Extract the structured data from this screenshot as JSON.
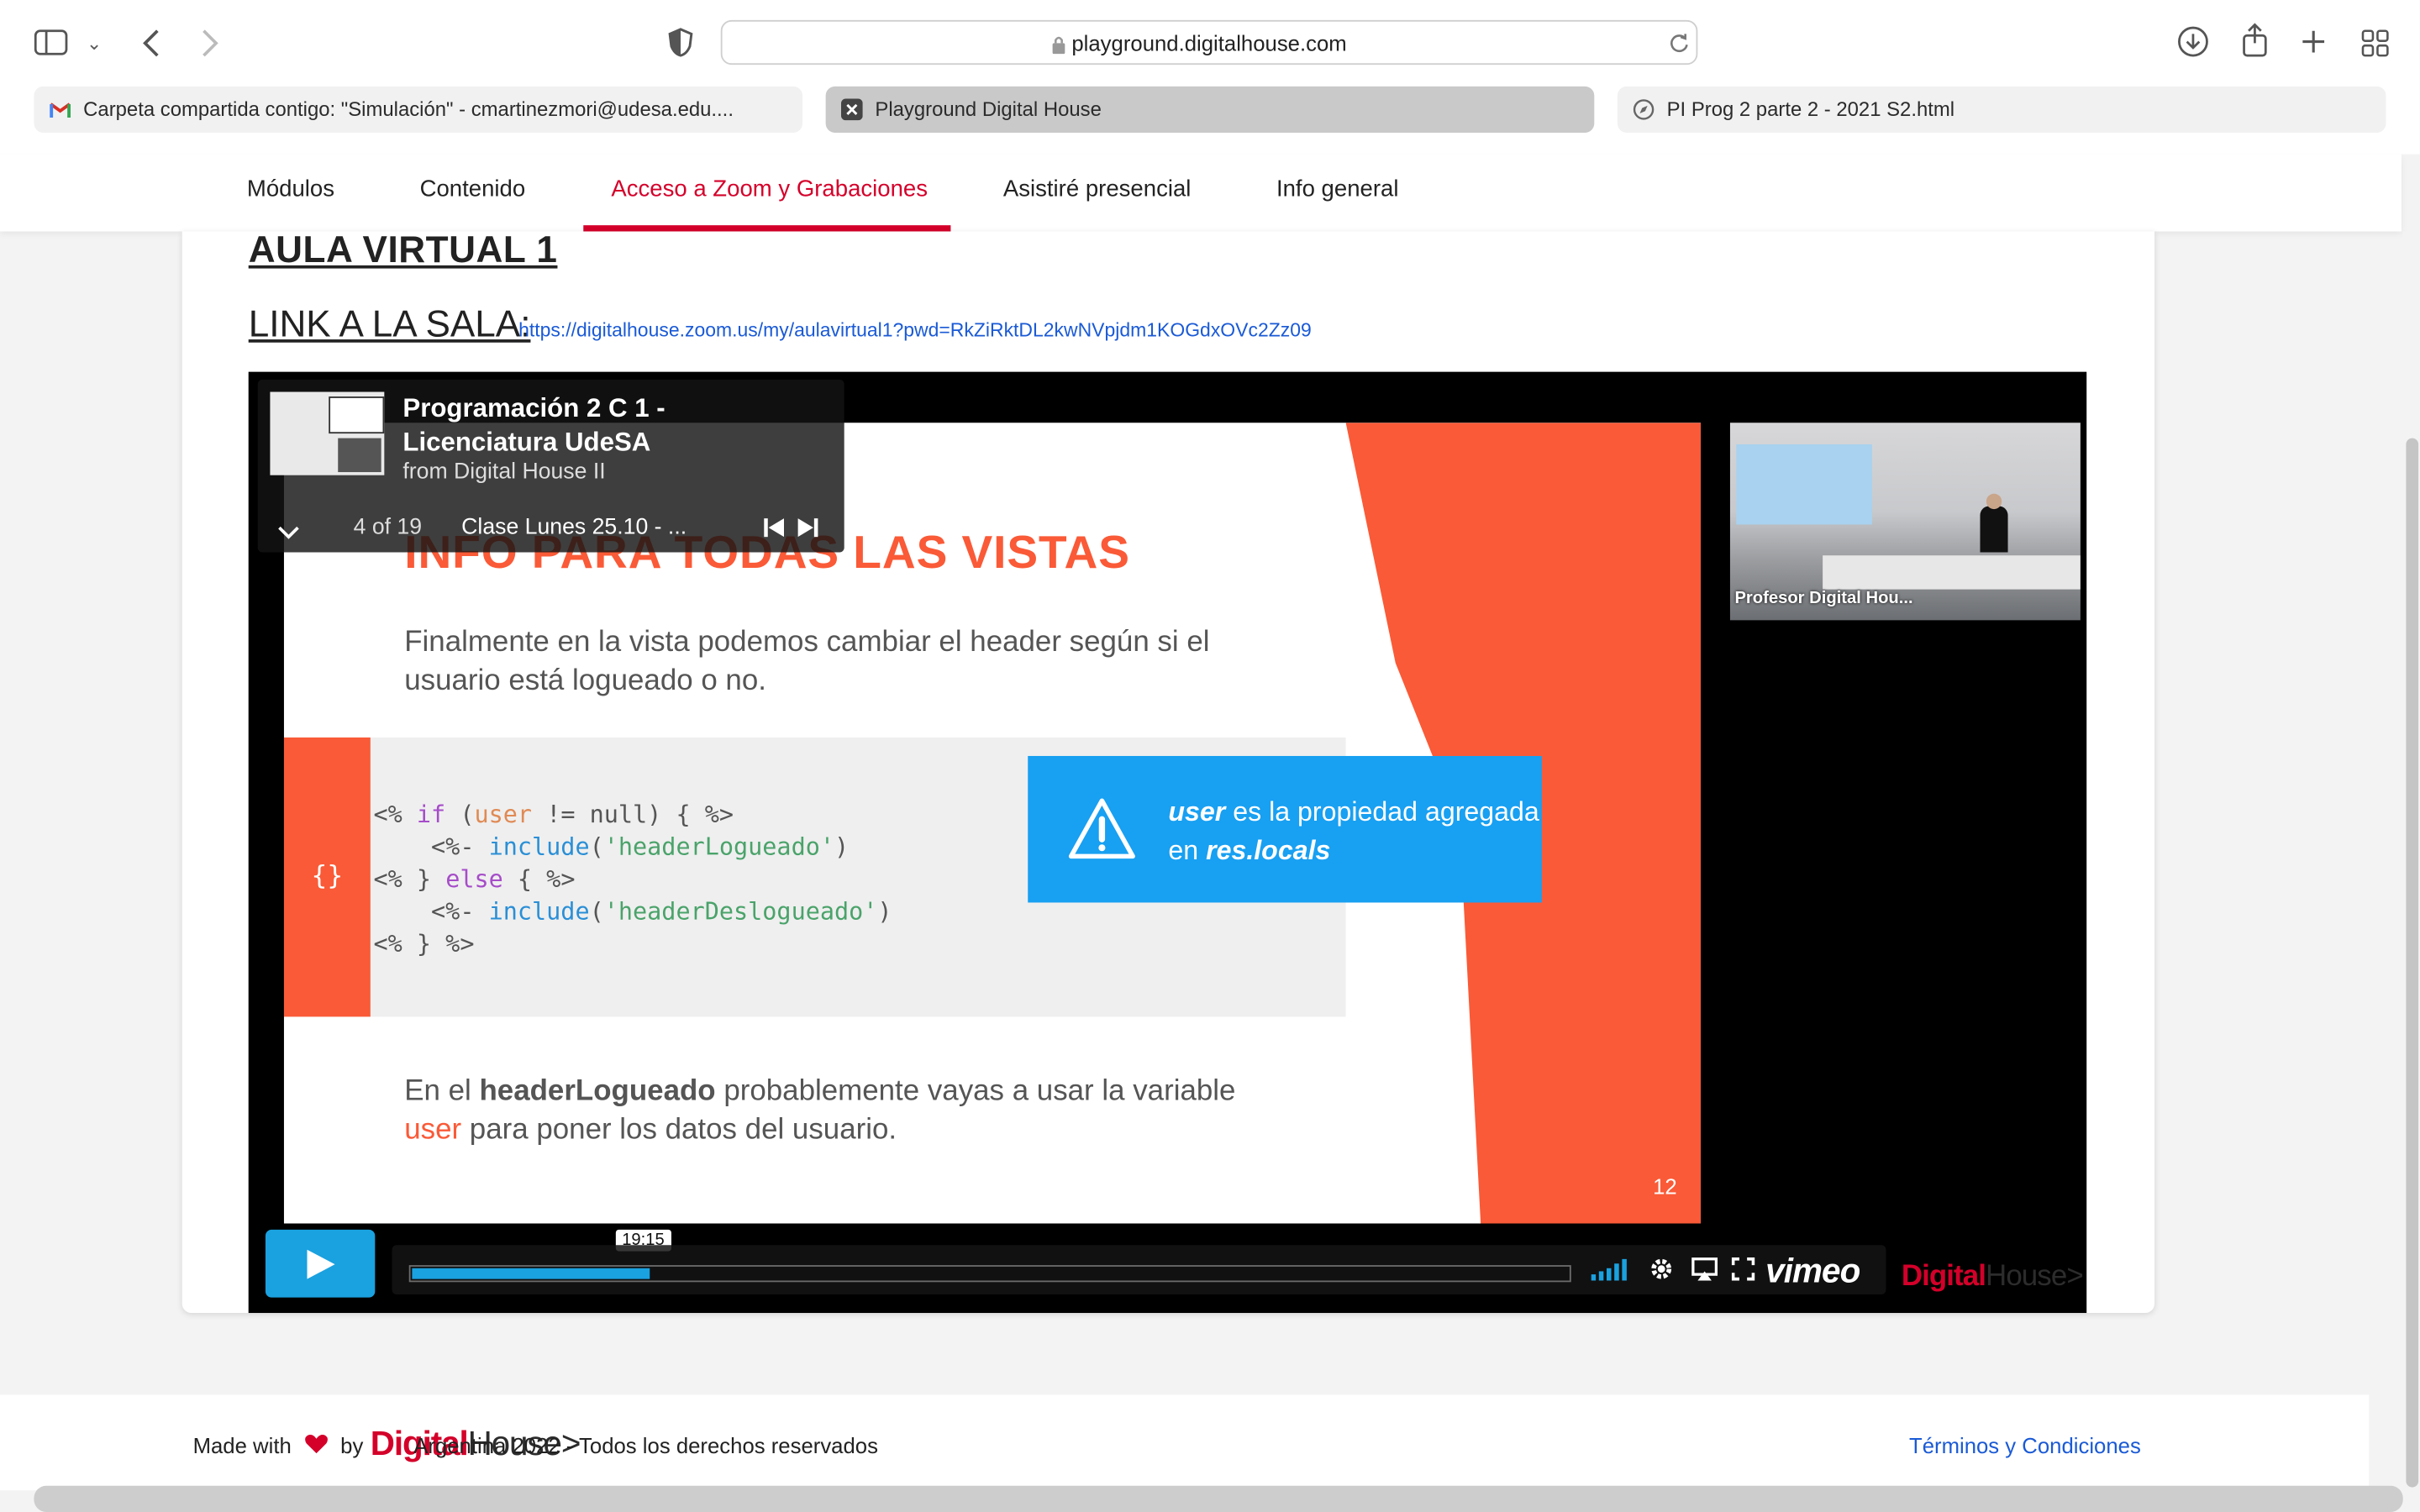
{
  "browser": {
    "url": "playground.digitalhouse.com",
    "tabs": [
      {
        "label": "Carpeta compartida contigo: \"Simulación\" - cmartinezmori@udesa.edu....",
        "icon": "gmail-icon"
      },
      {
        "label": "Playground Digital House",
        "icon": "close-icon"
      },
      {
        "label": "PI Prog 2 parte 2 - 2021 S2.html",
        "icon": "compass-icon"
      }
    ]
  },
  "nav": {
    "items": [
      "Módulos",
      "Contenido",
      "Acceso a Zoom y Grabaciones",
      "Asistiré presencial",
      "Info general"
    ],
    "active_index": 2
  },
  "main": {
    "heading": "AULA VIRTUAL 1",
    "link_label": "LINK A LA SALA:",
    "link_url": "https://digitalhouse.zoom.us/my/aulavirtual1?pwd=RkZiRktDL2kwNVpjdm1KOGdxOVc2Zz09"
  },
  "video": {
    "title": "Programación 2 C 1 - Licenciatura UdeSA",
    "from": "from Digital House II",
    "position": "4 of 19",
    "clip_title": "Clase Lunes 25.10 - ...",
    "time": "19:15",
    "progress": 0.205,
    "player_brand": "vimeo",
    "camera_label": "Profesor Digital Hou...",
    "slide": {
      "title": "INFO PARA TODAS LAS VISTAS",
      "p1": "Finalmente en la vista podemos cambiar el header según si el usuario está logueado o no.",
      "code_side": "{}",
      "callout_user": "user",
      "callout_mid": " es la propiedad agregada en ",
      "callout_locals": "res.locals",
      "p2_a": "En el ",
      "p2_b": "headerLogueado",
      "p2_c": " probablemente vayas a usar la variable ",
      "p2_d": "user",
      "p2_e": " para poner los datos del usuario.",
      "number": "12"
    },
    "overlay_brand_a": "Digital",
    "overlay_brand_b": "House>"
  },
  "footer": {
    "made_with": "Made with",
    "by": "by",
    "brand_a": "Digital",
    "brand_b": "House>",
    "rights": "Argentina 2022 - Todos los derechos reservados",
    "terms": "Términos y Condiciones"
  },
  "colors": {
    "accent": "#d4002a",
    "slide_orange": "#fa5a37",
    "callout_blue": "#18a0f2",
    "vimeo_blue": "#1aa1e0",
    "link": "#1a5ad6"
  }
}
